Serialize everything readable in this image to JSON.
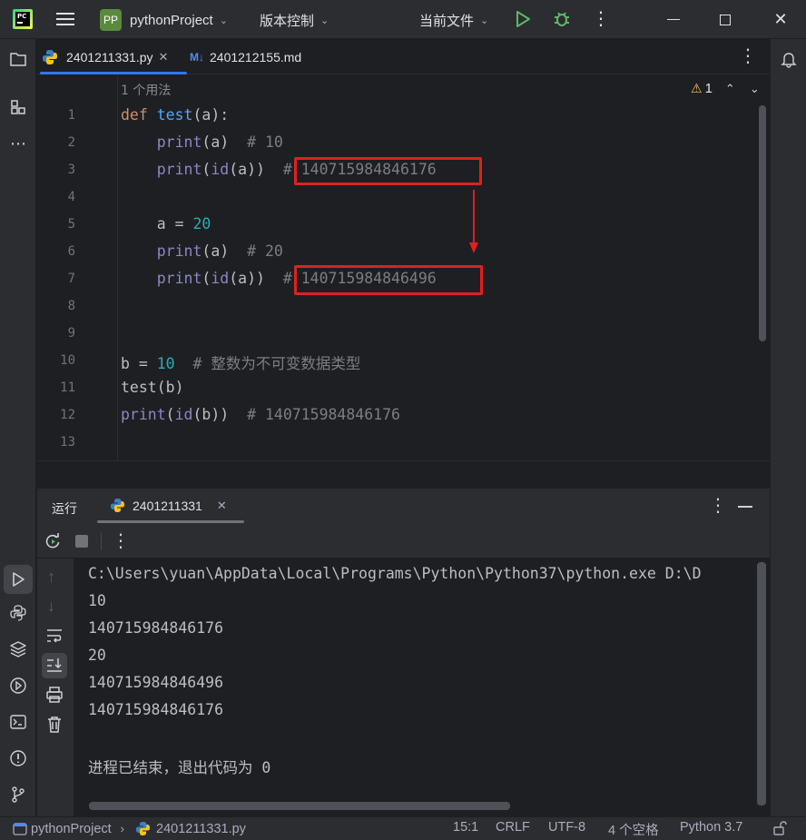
{
  "titlebar": {
    "project_badge": "PP",
    "project_name": "pythonProject",
    "vcs_label": "版本控制",
    "run_config": "当前文件"
  },
  "tabs": [
    {
      "label": "2401211331.py",
      "active": true
    },
    {
      "label": "2401212155.md",
      "prefix": "M↓"
    }
  ],
  "editor": {
    "usage_hint": "1 个用法",
    "warning_count": "1",
    "line_numbers": [
      "1",
      "2",
      "3",
      "4",
      "5",
      "6",
      "7",
      "8",
      "9",
      "10",
      "11",
      "12",
      "13"
    ],
    "lines": {
      "l1": {
        "kw": "def",
        "fn": "test",
        "rest": "(a):"
      },
      "l2": {
        "indent": "    ",
        "bi": "print",
        "rest": "(a)  ",
        "cm": "# 10"
      },
      "l3": {
        "indent": "    ",
        "bi": "print",
        "mid": "(",
        "bi2": "id",
        "rest": "(a))  ",
        "cm": "# 140715984846176"
      },
      "l5": {
        "indent": "    ",
        "rest": "a = ",
        "num": "20"
      },
      "l6": {
        "indent": "    ",
        "bi": "print",
        "rest": "(a)  ",
        "cm": "# 20"
      },
      "l7": {
        "indent": "    ",
        "bi": "print",
        "mid": "(",
        "bi2": "id",
        "rest": "(a))  ",
        "cm": "# 140715984846496"
      },
      "l10": {
        "rest": "b = ",
        "num": "10",
        "cm": "  # 整数为不可变数据类型"
      },
      "l11": {
        "rest": "test(b)"
      },
      "l12": {
        "bi": "print",
        "mid": "(",
        "bi2": "id",
        "rest": "(b))  ",
        "cm": "# 140715984846176"
      }
    }
  },
  "run": {
    "panel_label": "运行",
    "tab_label": "2401211331",
    "output": [
      "C:\\Users\\yuan\\AppData\\Local\\Programs\\Python\\Python37\\python.exe D:\\D",
      "10",
      "140715984846176",
      "20",
      "140715984846496",
      "140715984846176",
      "",
      "进程已结束，退出代码为 0"
    ]
  },
  "statusbar": {
    "project": "pythonProject",
    "file": "2401211331.py",
    "position": "15:1",
    "line_sep": "CRLF",
    "encoding": "UTF-8",
    "indent": "4 个空格",
    "interpreter": "Python 3.7"
  },
  "colors": {
    "accent_blue": "#3574f0",
    "highlight_red": "#e02020",
    "run_green": "#5fb865"
  }
}
